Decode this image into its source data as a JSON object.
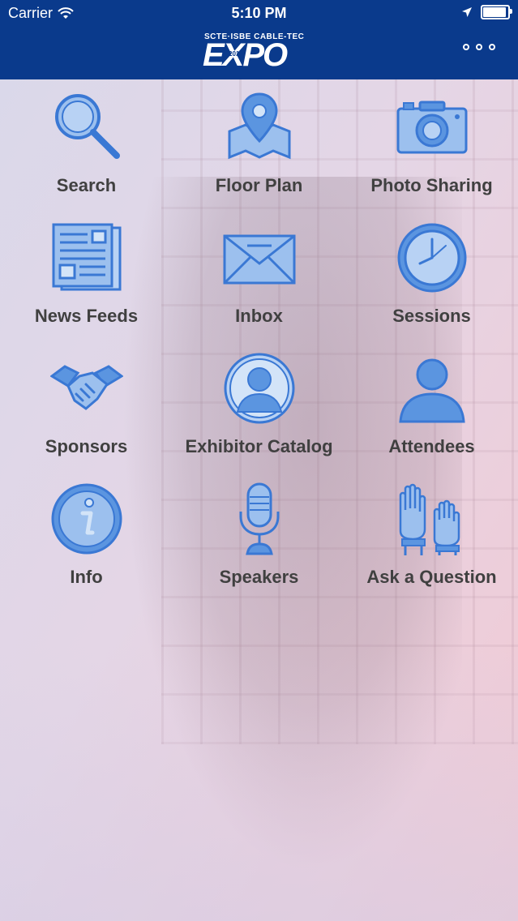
{
  "status_bar": {
    "carrier": "Carrier",
    "time": "5:10 PM",
    "wifi_icon": "wifi-icon",
    "location_icon": "location-arrow-icon",
    "battery_icon": "battery-icon"
  },
  "header": {
    "logo_top": "SCTE·ISBE CABLE-TEC",
    "logo_main": "EXPO",
    "logo_year": "2017",
    "more_icon": "more-dots-icon",
    "background_color": "#0a3a8c"
  },
  "menu": {
    "accent_color": "#3a78d4",
    "items": [
      {
        "label": "Search",
        "icon": "search-icon"
      },
      {
        "label": "Floor Plan",
        "icon": "map-pin-icon"
      },
      {
        "label": "Photo Sharing",
        "icon": "camera-icon"
      },
      {
        "label": "News Feeds",
        "icon": "newspaper-icon"
      },
      {
        "label": "Inbox",
        "icon": "envelope-icon"
      },
      {
        "label": "Sessions",
        "icon": "clock-icon"
      },
      {
        "label": "Sponsors",
        "icon": "handshake-icon"
      },
      {
        "label": "Exhibitor Catalog",
        "icon": "person-circle-icon"
      },
      {
        "label": "Attendees",
        "icon": "person-icon"
      },
      {
        "label": "Info",
        "icon": "info-icon"
      },
      {
        "label": "Speakers",
        "icon": "microphone-icon"
      },
      {
        "label": "Ask a Question",
        "icon": "raised-hands-icon"
      }
    ]
  }
}
